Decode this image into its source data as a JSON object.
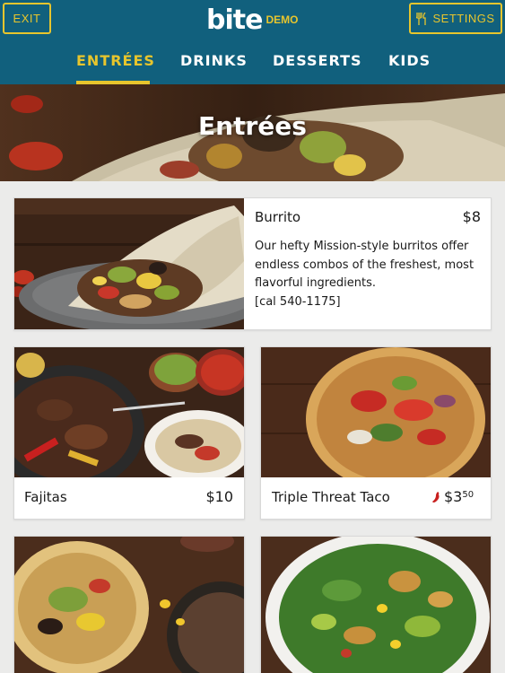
{
  "header": {
    "exit_label": "EXIT",
    "logo_text": "bite",
    "logo_badge": "DEMO",
    "settings_label": "SETTINGS",
    "settings_icon": "fork-knife-icon"
  },
  "tabs": [
    {
      "label": "ENTRÉES",
      "active": true
    },
    {
      "label": "DRINKS",
      "active": false
    },
    {
      "label": "DESSERTS",
      "active": false
    },
    {
      "label": "KIDS",
      "active": false
    }
  ],
  "hero": {
    "title": "Entrées"
  },
  "items": [
    {
      "name": "Burrito",
      "price": "$8",
      "description": "Our hefty Mission-style burritos offer endless combos of the freshest, most flavorful ingredients.",
      "calories": "[cal 540-1175]"
    },
    {
      "name": "Fajitas",
      "price": "$10"
    },
    {
      "name": "Triple Threat Taco",
      "price_main": "$3",
      "price_cents": "50",
      "icon": "chili-pepper-icon"
    }
  ],
  "colors": {
    "header_bg": "#11607d",
    "accent": "#e7c52d",
    "page_bg": "#ebebea",
    "chili": "#c8201f"
  }
}
